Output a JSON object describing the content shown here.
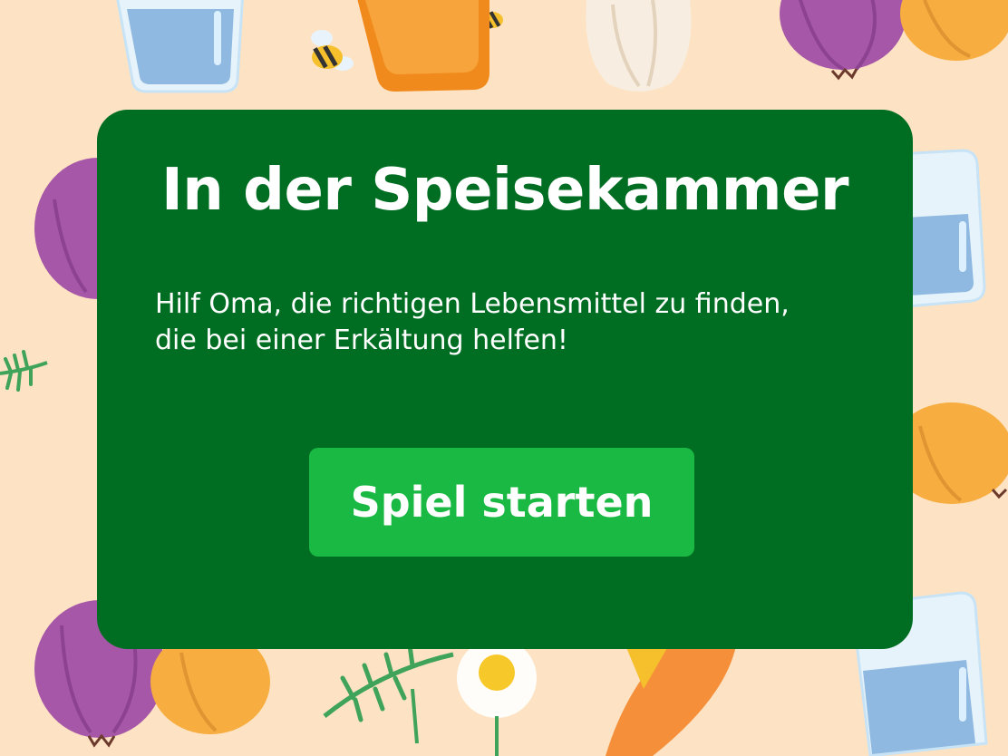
{
  "colors": {
    "background": "#fde3c3",
    "card": "#006e22",
    "button": "#1ab944",
    "text": "#ffffff"
  },
  "intro": {
    "title": "In der Speisekammer",
    "description_lines": [
      "Hilf Oma, die richtigen Lebensmittel zu finden,",
      "die bei einer Erkältung helfen!"
    ],
    "start_button_label": "Spiel starten"
  },
  "background_icons": [
    "water-glass-icon",
    "bee-icon",
    "honey-jar-icon",
    "garlic-icon",
    "red-onion-icon",
    "yellow-onion-icon",
    "herb-sprig-icon",
    "chamomile-flower-icon",
    "carrot-icon"
  ]
}
